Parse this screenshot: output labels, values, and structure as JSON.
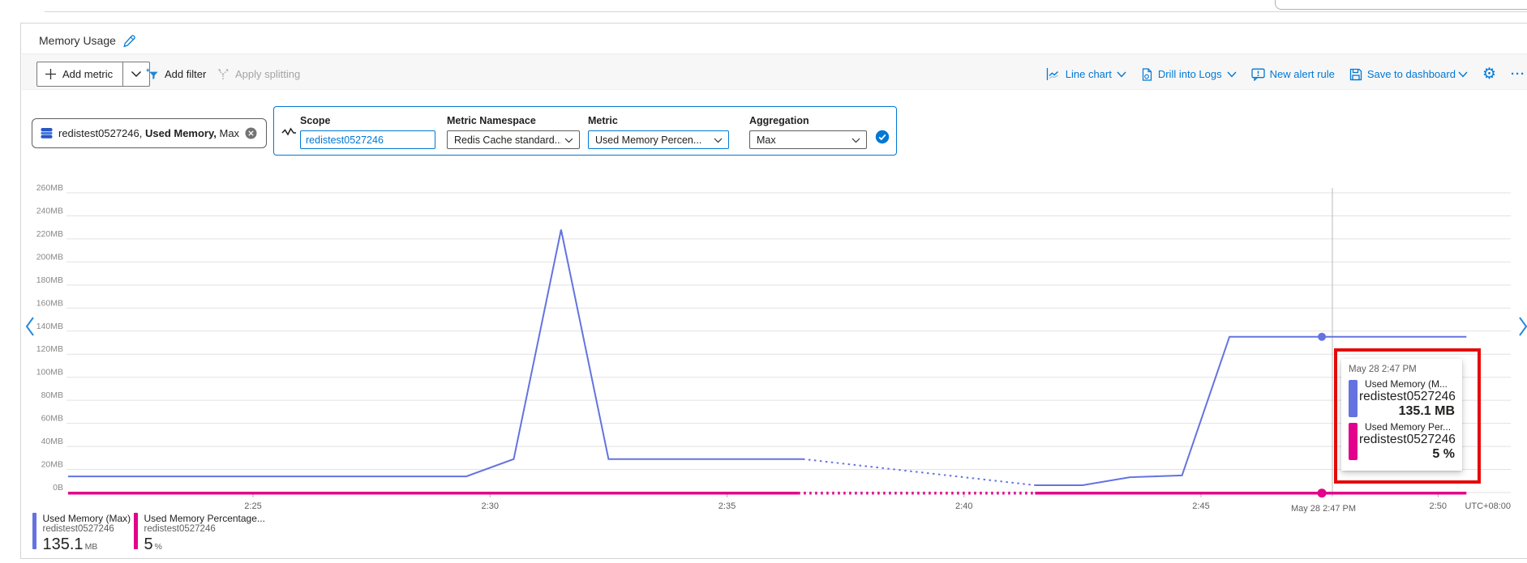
{
  "header": {
    "title": "Memory Usage"
  },
  "toolbar": {
    "add_metric": "Add metric",
    "add_filter": "Add filter",
    "apply_splitting": "Apply splitting",
    "chart_type": "Line chart",
    "drill": "Drill into Logs",
    "alert": "New alert rule",
    "save": "Save to dashboard",
    "more": "..."
  },
  "metric_pill": {
    "resource": "redistest0527246, ",
    "metric": "Used Memory,",
    "aggregation": " Max"
  },
  "editor": {
    "scope": {
      "label": "Scope",
      "value": "redistest0527246"
    },
    "namespace": {
      "label": "Metric Namespace",
      "value": "Redis Cache standard..."
    },
    "metric": {
      "label": "Metric",
      "value": "Used Memory Percen..."
    },
    "aggregation": {
      "label": "Aggregation",
      "value": "Max"
    }
  },
  "chart_data": {
    "type": "line",
    "title": "Memory Usage",
    "ylim": [
      0,
      260
    ],
    "y_unit": "MB",
    "grid": true,
    "legend_position": "bottom",
    "y_tick_labels": [
      "0B",
      "20MB",
      "40MB",
      "60MB",
      "80MB",
      "100MB",
      "120MB",
      "140MB",
      "160MB",
      "180MB",
      "200MB",
      "220MB",
      "240MB",
      "260MB"
    ],
    "x_tick_labels": [
      {
        "label": "2:25",
        "t": 25
      },
      {
        "label": "2:30",
        "t": 30
      },
      {
        "label": "2:35",
        "t": 35
      },
      {
        "label": "2:40",
        "t": 40
      },
      {
        "label": "2:45",
        "t": 45
      },
      {
        "label": "2:50",
        "t": 50
      }
    ],
    "timezone": "UTC+08:00",
    "cursor": {
      "label": "May 28 2:47 PM",
      "t": 47.55
    },
    "series": [
      {
        "name": "Used Memory (Max)",
        "resource": "redistest0527246",
        "color": "#6473e0",
        "unit": "MB",
        "value_at_cursor": 135.1,
        "segments": [
          {
            "style": "solid",
            "points": [
              [
                21.1,
                14
              ],
              [
                29.5,
                14
              ],
              [
                30.5,
                29
              ],
              [
                31.5,
                228
              ],
              [
                32.5,
                29
              ],
              [
                36.6,
                29
              ]
            ]
          },
          {
            "style": "dotted",
            "points": [
              [
                36.6,
                29
              ],
              [
                41.5,
                6.3
              ]
            ]
          },
          {
            "style": "solid",
            "points": [
              [
                41.5,
                6.3
              ],
              [
                42.5,
                6.3
              ],
              [
                43.5,
                13.3
              ],
              [
                44.6,
                14.8
              ],
              [
                45.6,
                135.1
              ],
              [
                50.6,
                135.1
              ]
            ]
          }
        ],
        "marker": [
          47.55,
          135.1
        ]
      },
      {
        "name": "Used Memory Percentage...",
        "resource": "redistest0527246",
        "color": "#e3008c",
        "unit": "%",
        "value_at_cursor": 5,
        "segments": [
          {
            "style": "solid",
            "points": [
              [
                21.1,
                5
              ],
              [
                36.5,
                5
              ]
            ]
          },
          {
            "style": "dotted",
            "points": [
              [
                36.5,
                5
              ],
              [
                41.5,
                5
              ]
            ]
          },
          {
            "style": "solid",
            "points": [
              [
                41.5,
                5
              ],
              [
                50.6,
                5
              ]
            ]
          }
        ],
        "marker": [
          47.55,
          5
        ]
      }
    ]
  },
  "tooltip": {
    "time": "May 28 2:47 PM",
    "items": [
      {
        "label": "Used Memory (M...",
        "name": "redistest0527246",
        "value": "135.1 MB",
        "color": "#6473e0"
      },
      {
        "label": "Used Memory Per...",
        "name": "redistest0527246",
        "value": "5 %",
        "color": "#e3008c"
      }
    ]
  },
  "legend": {
    "items": [
      {
        "name": "Used Memory (Max)",
        "resource": "redistest0527246",
        "value": "135.1",
        "unit": "MB",
        "color": "#6473e0"
      },
      {
        "name": "Used Memory Percentage...",
        "resource": "redistest0527246",
        "value": "5",
        "unit": "%",
        "color": "#e3008c"
      }
    ]
  }
}
